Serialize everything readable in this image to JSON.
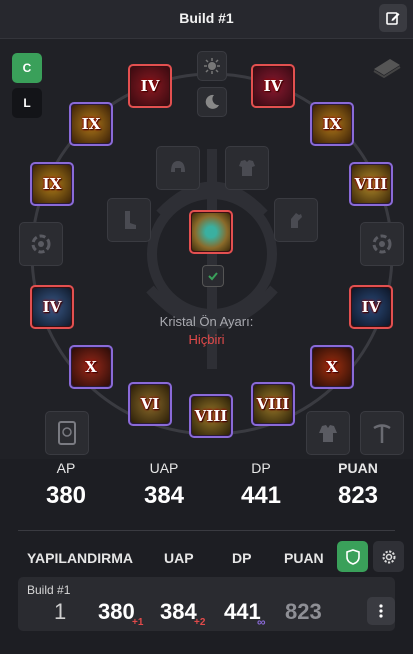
{
  "header": {
    "title": "Build #1",
    "edit_icon": "edit-icon"
  },
  "modes": {
    "c": "C",
    "l": "L"
  },
  "slots": [
    {
      "name": "top-left-artifact",
      "rank": "IV"
    },
    {
      "name": "top-right-artifact",
      "rank": "IV"
    },
    {
      "name": "ring-left",
      "rank": "IX"
    },
    {
      "name": "ring-right",
      "rank": "IX"
    },
    {
      "name": "necklace-left",
      "rank": "IX"
    },
    {
      "name": "belt-right",
      "rank": "VIII"
    },
    {
      "name": "gloves-left",
      "rank": "IV"
    },
    {
      "name": "gloves-right",
      "rank": "IV"
    },
    {
      "name": "weapon-left",
      "rank": "X"
    },
    {
      "name": "weapon-right",
      "rank": "X"
    },
    {
      "name": "bottom-1",
      "rank": "VI"
    },
    {
      "name": "bottom-2",
      "rank": "VIII"
    },
    {
      "name": "bottom-3",
      "rank": "VIII"
    }
  ],
  "crystal": {
    "label": "Kristal Ön Ayarı:",
    "value": "Hiçbiri"
  },
  "stats": [
    {
      "label": "AP",
      "value": "380"
    },
    {
      "label": "UAP",
      "value": "384"
    },
    {
      "label": "DP",
      "value": "441"
    },
    {
      "label": "PUAN",
      "value": "823"
    }
  ],
  "table": {
    "headers": [
      "YAPILANDIRMA",
      "UAP",
      "DP",
      "PUAN"
    ],
    "row": {
      "name": "Build #1",
      "index": "1",
      "ap": "380",
      "ap_delta": "+1",
      "uap": "384",
      "uap_delta": "+2",
      "dp": "441",
      "dp_mark": "∞",
      "puan": "823"
    }
  },
  "colors": {
    "accent_green": "#3aa05a",
    "red": "#e24a4a",
    "purple_border": "#8a6ad8",
    "red_border": "#e35050"
  }
}
